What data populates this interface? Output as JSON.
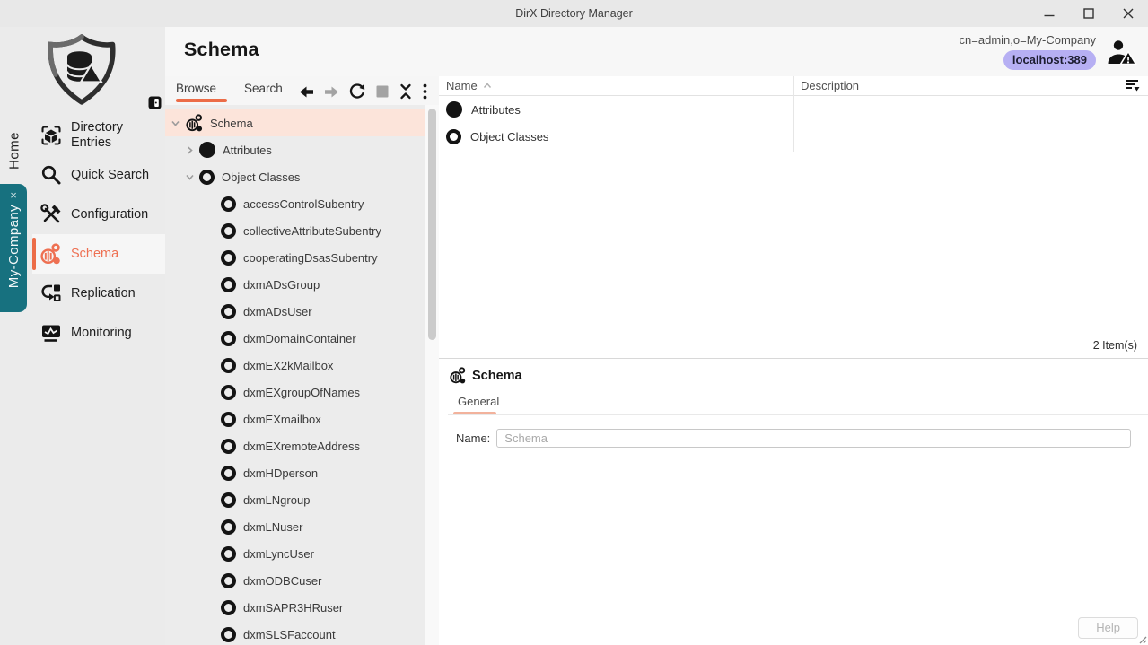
{
  "window": {
    "title": "DirX Directory Manager"
  },
  "sidebar": {
    "home_label": "Home",
    "company_label": "My-Company",
    "company_close": "×",
    "items": [
      {
        "label": "Directory Entries",
        "icon": "cube-brackets-icon",
        "active": false
      },
      {
        "label": "Quick Search",
        "icon": "magnifier-icon",
        "active": false
      },
      {
        "label": "Configuration",
        "icon": "tools-icon",
        "active": false
      },
      {
        "label": "Schema",
        "icon": "schema-hive-icon",
        "active": true
      },
      {
        "label": "Replication",
        "icon": "replication-icon",
        "active": false
      },
      {
        "label": "Monitoring",
        "icon": "monitor-icon",
        "active": false
      }
    ]
  },
  "header": {
    "page_title": "Schema",
    "connection_dn": "cn=admin,o=My-Company",
    "connection_host": "localhost:389",
    "user_icon": "user-warning-icon"
  },
  "browser": {
    "tabs": [
      {
        "label": "Browse",
        "active": true
      },
      {
        "label": "Search",
        "active": false
      }
    ],
    "toolbar_icons": [
      "back-icon",
      "forward-icon",
      "refresh-icon",
      "stop-icon",
      "collapse-all-icon",
      "kebab-menu-icon"
    ],
    "tree": {
      "root": "Schema",
      "attributes_label": "Attributes",
      "object_classes_label": "Object Classes",
      "object_classes": [
        "accessControlSubentry",
        "collectiveAttributeSubentry",
        "cooperatingDsasSubentry",
        "dxmADsGroup",
        "dxmADsUser",
        "dxmDomainContainer",
        "dxmEX2kMailbox",
        "dxmEXgroupOfNames",
        "dxmEXmailbox",
        "dxmEXremoteAddress",
        "dxmHDperson",
        "dxmLNgroup",
        "dxmLNuser",
        "dxmLyncUser",
        "dxmODBCuser",
        "dxmSAPR3HRuser",
        "dxmSLSFaccount"
      ]
    }
  },
  "table": {
    "columns": [
      "Name",
      "Description"
    ],
    "rows": [
      {
        "name": "Attributes",
        "icon": "filled-circle-icon",
        "description": ""
      },
      {
        "name": "Object Classes",
        "icon": "ring-icon",
        "description": ""
      }
    ],
    "count_label": "2 Item(s)"
  },
  "detail": {
    "title": "Schema",
    "tab_general": "General",
    "name_label": "Name:",
    "name_value": "",
    "name_placeholder": "Schema",
    "help_label": "Help"
  },
  "colors": {
    "accent_orange": "#ec6c47",
    "selected_row": "#fce4da",
    "tab_underline_light": "#f2b29c",
    "teal_tab": "#17717f",
    "host_badge": "#b6aff3",
    "sidebar_bg": "#ebebeb",
    "tree_bg": "#ececec",
    "titlebar_bg": "#e8e8e8"
  }
}
